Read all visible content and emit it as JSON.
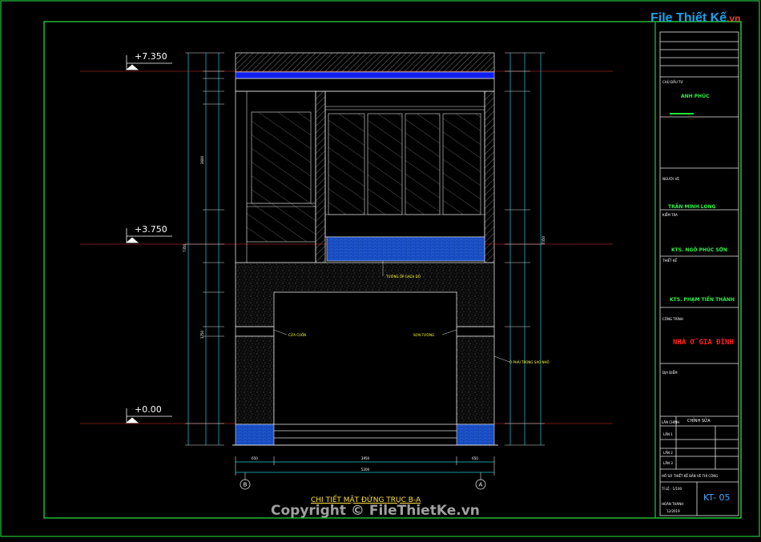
{
  "logo": {
    "text": "File Thiết Kế",
    "suffix": ".vn"
  },
  "watermark": "Copyright © FileThietKe.vn",
  "drawing": {
    "title": "CHI TIẾT MẶT ĐỨNG TRỤC B-A",
    "elevations": [
      "+7.350",
      "+3.750",
      "+0.00"
    ],
    "grid_axes": [
      "B",
      "A"
    ],
    "notes": {
      "balcony": "TƯỜNG ỐP GẠCH ĐỎ",
      "door_left": "CỬA CUỐN",
      "door_right": "SƠN TƯỜNG",
      "side": "Ô PHẢI TRONG SAO NHỎ"
    },
    "dims": {
      "left_total": "7350",
      "left_floor2": "3600",
      "left_floor1": "3750",
      "bottom_total": "5200",
      "bottom_mid": "3950",
      "bottom_left": "650",
      "bottom_right": "650"
    }
  },
  "title_block": {
    "owner_label": "CHỦ ĐẦU TƯ",
    "owner_name": "ANH PHÚC",
    "designer_label": "NGƯỜI VẼ",
    "designer_name": "TRẦN MINH LONG",
    "checker_label": "KIỂM TRA",
    "checker_name": "KTS. NGÔ PHÚC SƠN",
    "chief_label": "THIẾT KẾ",
    "chief_name": "KTS. PHẠM TIẾN THÀNH",
    "project_label": "CÔNG TRÌNH",
    "project_name": "NHÀ Ở GIA ĐÌNH",
    "address_label": "ĐỊA ĐIỂM",
    "rev_header": "LẦN CHỈNH",
    "rev_header2": "CHỈNH SỬA",
    "rev_rows": [
      "LẦN 1",
      "LẦN 2",
      "LẦN 3"
    ],
    "stage": "HỒ SƠ THIẾT KẾ BẢN VẼ THI CÔNG",
    "scale": "TỈ LỆ : 1/100",
    "completed": "HOÀN THÀNH",
    "date": "12/2019",
    "sheet_no": "KT- 05"
  },
  "colors": {
    "frame_green": "#22c43a",
    "glass_gray": "#8a8a8a",
    "tile_blue": "#1f5ad8",
    "beam_blue": "#1020f0",
    "level_red": "#9a2020",
    "dim_cyan": "#20c8d8",
    "note_yellow": "#ffff33"
  }
}
